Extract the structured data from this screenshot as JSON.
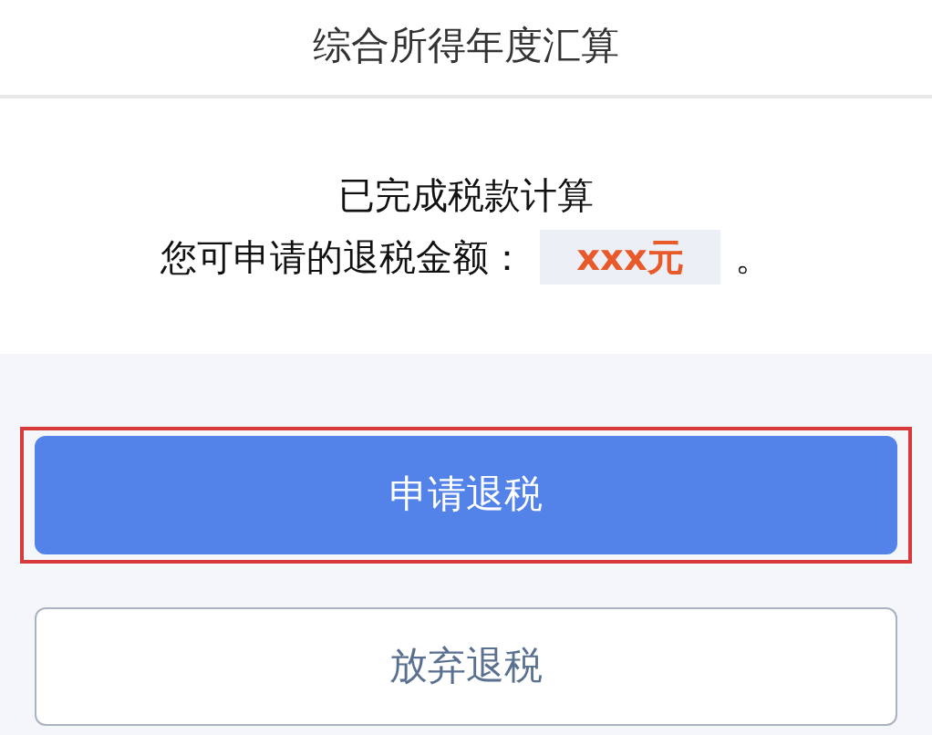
{
  "header": {
    "title": "综合所得年度汇算"
  },
  "result": {
    "heading": "已完成税款计算",
    "label": "您可申请的退税金额：",
    "amount": "xxx元",
    "suffix": "。"
  },
  "buttons": [
    {
      "label": "申请退税",
      "kind": "primary",
      "highlighted": true
    },
    {
      "label": "放弃退税",
      "kind": "secondary",
      "highlighted": false
    }
  ]
}
